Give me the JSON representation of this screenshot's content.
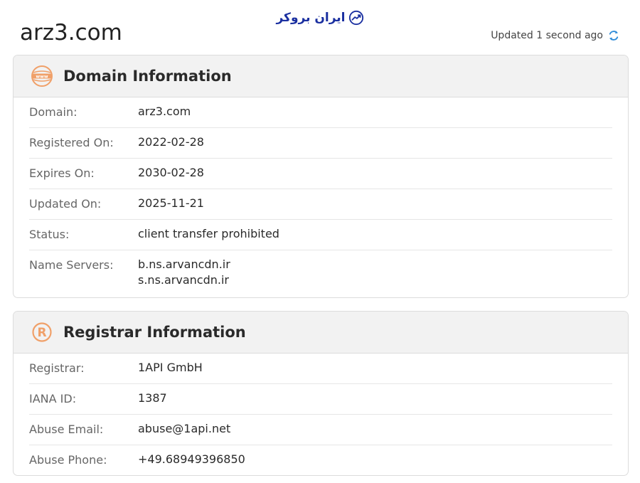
{
  "brand": {
    "name": "ایران بروکر"
  },
  "header": {
    "domain": "arz3.com",
    "updated_text": "Updated 1 second ago"
  },
  "domain_info": {
    "title": "Domain Information",
    "rows": [
      {
        "label": "Domain:",
        "value": "arz3.com"
      },
      {
        "label": "Registered On:",
        "value": "2022-02-28"
      },
      {
        "label": "Expires On:",
        "value": "2030-02-28"
      },
      {
        "label": "Updated On:",
        "value": "2025-11-21"
      },
      {
        "label": "Status:",
        "value": "client transfer prohibited"
      }
    ],
    "name_servers": {
      "label": "Name Servers:",
      "values": [
        "b.ns.arvancdn.ir",
        "s.ns.arvancdn.ir"
      ]
    }
  },
  "registrar_info": {
    "title": "Registrar Information",
    "rows": [
      {
        "label": "Registrar:",
        "value": "1API GmbH"
      },
      {
        "label": "IANA ID:",
        "value": "1387"
      },
      {
        "label": "Abuse Email:",
        "value": "abuse@1api.net"
      },
      {
        "label": "Abuse Phone:",
        "value": "+49.68949396850"
      }
    ]
  },
  "colors": {
    "brand": "#1a2fa0",
    "accent_orange": "#f0a069",
    "refresh_blue": "#2e8bd8"
  },
  "icons": {
    "brand": "chart-trend-icon",
    "refresh": "refresh-icon",
    "domain": "www-globe-icon",
    "registrar": "registered-icon"
  }
}
